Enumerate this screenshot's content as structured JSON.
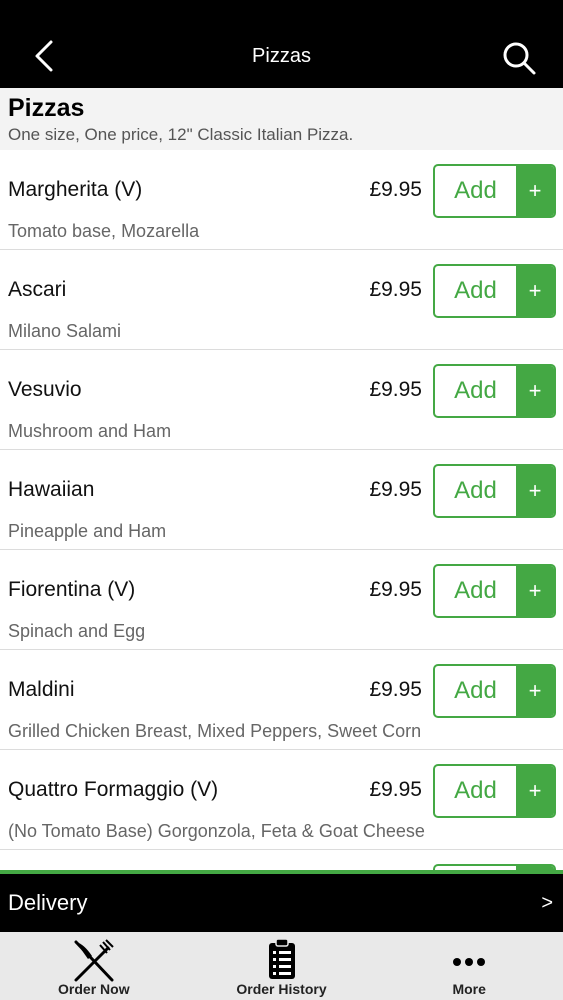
{
  "navbar": {
    "title": "Pizzas",
    "back_icon": "chevron-left-icon",
    "search_icon": "search-icon"
  },
  "section": {
    "title": "Pizzas",
    "subtitle": "One size, One price, 12\" Classic Italian Pizza."
  },
  "items": [
    {
      "name": "Margherita (V)",
      "desc": "Tomato base, Mozarella",
      "price": "£9.95",
      "add_label": "Add",
      "plus": "+"
    },
    {
      "name": "Ascari",
      "desc": "Milano Salami",
      "price": "£9.95",
      "add_label": "Add",
      "plus": "+"
    },
    {
      "name": "Vesuvio",
      "desc": "Mushroom and Ham",
      "price": "£9.95",
      "add_label": "Add",
      "plus": "+"
    },
    {
      "name": "Hawaiian",
      "desc": "Pineapple and Ham",
      "price": "£9.95",
      "add_label": "Add",
      "plus": "+"
    },
    {
      "name": "Fiorentina (V)",
      "desc": "Spinach and Egg",
      "price": "£9.95",
      "add_label": "Add",
      "plus": "+"
    },
    {
      "name": "Maldini",
      "desc": "Grilled Chicken Breast, Mixed Peppers, Sweet Corn",
      "price": "£9.95",
      "add_label": "Add",
      "plus": "+"
    },
    {
      "name": "Quattro Formaggio (V)",
      "desc": "(No Tomato Base) Gorgonzola, Feta & Goat Cheese",
      "price": "£9.95",
      "add_label": "Add",
      "plus": "+"
    }
  ],
  "delivery": {
    "label": "Delivery",
    "chevron": ">"
  },
  "tabs": [
    {
      "label": "Order Now",
      "icon": "fork-knife-icon"
    },
    {
      "label": "Order History",
      "icon": "clipboard-icon"
    },
    {
      "label": "More",
      "icon": "more-dots-icon"
    }
  ],
  "colors": {
    "accent": "#44a844",
    "navbar": "#000000",
    "section_bg": "#f3f3f3",
    "tabbar_bg": "#e9e9e9"
  }
}
